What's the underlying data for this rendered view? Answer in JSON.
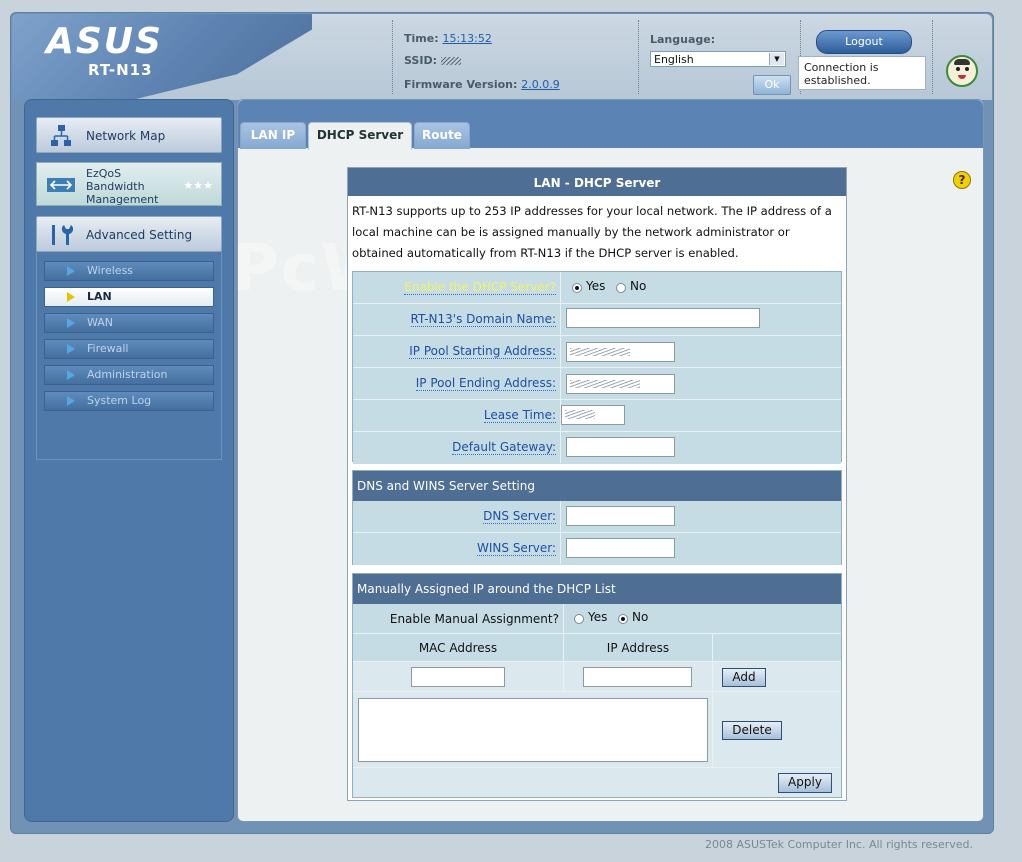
{
  "header": {
    "brand": "ASUS",
    "model": "RT-N13",
    "time_label": "Time:",
    "time_value": "15:13:52",
    "ssid_label": "SSID:",
    "firmware_label": "Firmware Version:",
    "firmware_value": "2.0.0.9",
    "language_label": "Language:",
    "language_value": "English",
    "ok_label": "Ok",
    "logout_label": "Logout",
    "connection_status": "Connection is established."
  },
  "sidebar": {
    "main_items": [
      {
        "label": "Network Map",
        "icon": "network-map-icon"
      },
      {
        "label": "EzQoS Bandwidth Management",
        "icon": "qos-icon"
      },
      {
        "label": "Advanced Setting",
        "icon": "tools-icon"
      }
    ],
    "sub_items": [
      {
        "label": "Wireless",
        "active": false
      },
      {
        "label": "LAN",
        "active": true
      },
      {
        "label": "WAN",
        "active": false
      },
      {
        "label": "Firewall",
        "active": false
      },
      {
        "label": "Administration",
        "active": false
      },
      {
        "label": "System Log",
        "active": false
      }
    ]
  },
  "tabs": [
    {
      "label": "LAN IP",
      "active": false
    },
    {
      "label": "DHCP Server",
      "active": true
    },
    {
      "label": "Route",
      "active": false
    }
  ],
  "panel": {
    "title": "LAN - DHCP Server",
    "description": "RT-N13 supports up to 253 IP addresses for your local network. The IP address of a local machine can be is assigned manually by the network administrator or obtained automatically from RT-N13 if the DHCP server is enabled.",
    "enable_dhcp_label": "Enable the DHCP Server?",
    "enable_dhcp_value": "Yes",
    "yes_label": "Yes",
    "no_label": "No",
    "domain_name_label": "RT-N13's Domain Name:",
    "domain_name_value": "",
    "pool_start_label": "IP Pool Starting Address:",
    "pool_end_label": "IP Pool Ending Address:",
    "lease_time_label": "Lease Time:",
    "gateway_label": "Default Gateway:",
    "gateway_value": "",
    "dns_section_title": "DNS and WINS Server Setting",
    "dns_label": "DNS Server:",
    "dns_value": "",
    "wins_label": "WINS Server:",
    "wins_value": "",
    "manual_section_title": "Manually Assigned IP around the DHCP List",
    "manual_enable_label": "Enable Manual Assignment?",
    "manual_enable_value": "No",
    "mac_header": "MAC Address",
    "ip_header": "IP Address",
    "add_label": "Add",
    "delete_label": "Delete",
    "apply_label": "Apply"
  },
  "footer": "2008 ASUSTek Computer Inc. All rights reserved.",
  "watermark": "PcWinTech.com",
  "colors": {
    "panel_header": "#4f6e94",
    "row_bg": "#c6dce4",
    "sidebar_bg": "#4e79a8",
    "highlight_label": "#f2f26a"
  }
}
